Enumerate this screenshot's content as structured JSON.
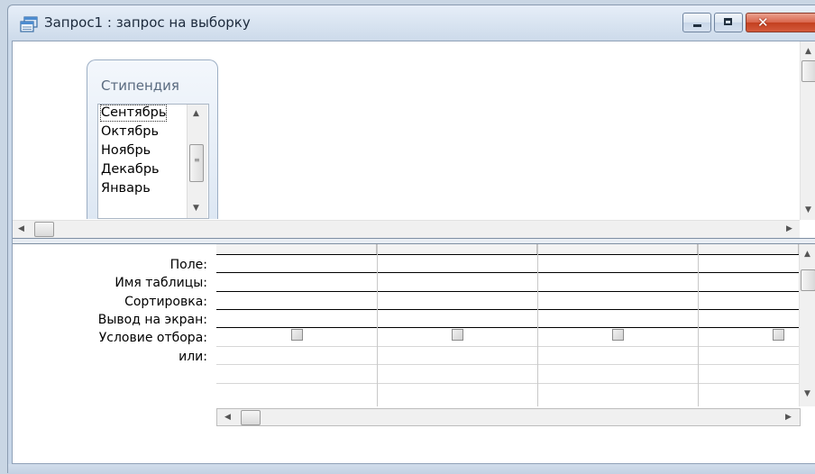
{
  "window": {
    "title": "Запрос1 : запрос на выборку",
    "controls": {
      "minimize": "minimize",
      "maximize": "maximize",
      "close": "✕"
    }
  },
  "table": {
    "name": "Стипендия",
    "fields": [
      "Сентябрь",
      "Октябрь",
      "Ноябрь",
      "Декабрь",
      "Январь"
    ],
    "selected_field": "Сентябрь"
  },
  "grid": {
    "row_labels": [
      "Поле:",
      "Имя таблицы:",
      "Сортировка:",
      "Вывод на экран:",
      "Условие отбора:",
      "или:"
    ],
    "columns": 4,
    "show_checkboxes": [
      false,
      false,
      false,
      false
    ]
  },
  "icons": {
    "window": "query-window-icon",
    "scroll_up": "▲",
    "scroll_down": "▼",
    "scroll_left": "◀",
    "scroll_right": "▶",
    "grip": "≡"
  },
  "colors": {
    "frame": "#ccdaea",
    "close": "#c3401f",
    "grid_lines": "#000000"
  }
}
